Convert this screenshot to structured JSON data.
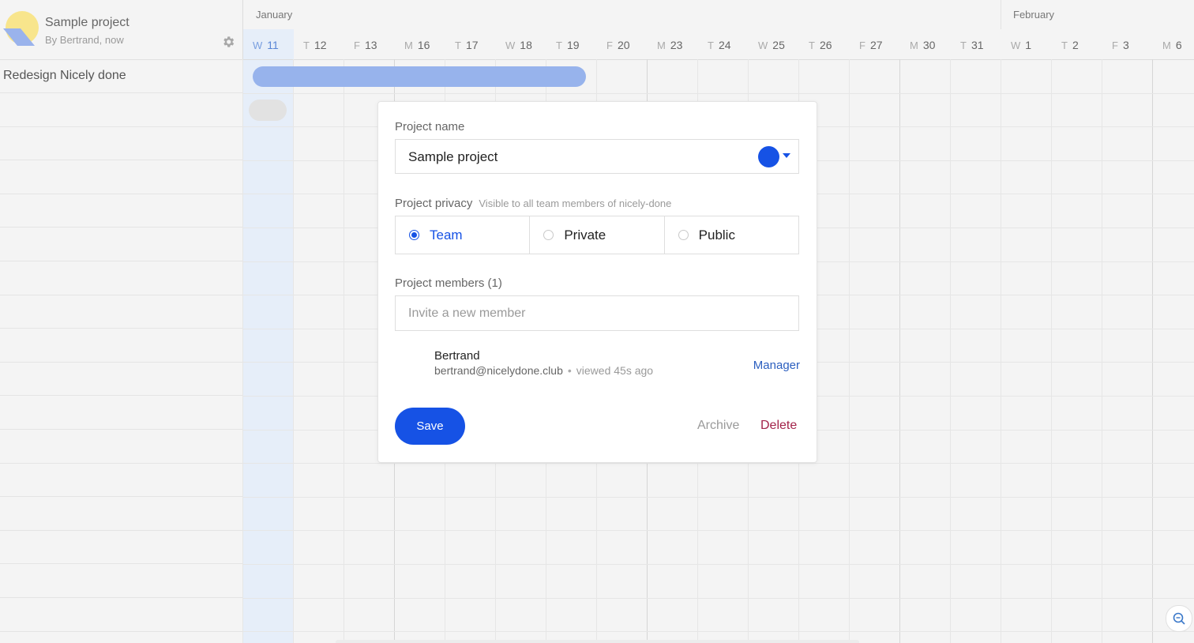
{
  "sidebar": {
    "project_title": "Sample project",
    "project_subtitle": "By Bertrand, now",
    "rows": [
      {
        "label": "Redesign Nicely done"
      }
    ]
  },
  "timeline": {
    "months": [
      {
        "label": "January"
      },
      {
        "label": "February"
      }
    ],
    "days": [
      {
        "letter": "W",
        "num": "11",
        "today": true
      },
      {
        "letter": "T",
        "num": "12"
      },
      {
        "letter": "F",
        "num": "13"
      },
      {
        "letter": "M",
        "num": "16"
      },
      {
        "letter": "T",
        "num": "17"
      },
      {
        "letter": "W",
        "num": "18"
      },
      {
        "letter": "T",
        "num": "19"
      },
      {
        "letter": "F",
        "num": "20"
      },
      {
        "letter": "M",
        "num": "23"
      },
      {
        "letter": "T",
        "num": "24"
      },
      {
        "letter": "W",
        "num": "25"
      },
      {
        "letter": "T",
        "num": "26"
      },
      {
        "letter": "F",
        "num": "27"
      },
      {
        "letter": "M",
        "num": "30"
      },
      {
        "letter": "T",
        "num": "31"
      },
      {
        "letter": "W",
        "num": "1"
      },
      {
        "letter": "T",
        "num": "2"
      },
      {
        "letter": "F",
        "num": "3"
      },
      {
        "letter": "M",
        "num": "6"
      }
    ]
  },
  "modal": {
    "name_label": "Project name",
    "name_value": "Sample project",
    "project_color": "#1652e5",
    "privacy_label": "Project privacy",
    "privacy_hint": "Visible to all team members of nicely-done",
    "privacy_options": [
      {
        "label": "Team",
        "selected": true
      },
      {
        "label": "Private",
        "selected": false
      },
      {
        "label": "Public",
        "selected": false
      }
    ],
    "members_label": "Project members (1)",
    "invite_placeholder": "Invite a new member",
    "members": [
      {
        "name": "Bertrand",
        "email": "bertrand@nicelydone.club",
        "separator": "•",
        "viewed": "viewed 45s ago",
        "role": "Manager"
      }
    ],
    "save_label": "Save",
    "archive_label": "Archive",
    "delete_label": "Delete"
  },
  "colors": {
    "accent": "#1652e5",
    "bar": "#97b3ec",
    "today": "#e6eef9",
    "delete": "#a3244a"
  },
  "icons": {
    "logo": "logo-icon",
    "settings": "gear-icon",
    "zoom": "zoom-out-icon"
  }
}
